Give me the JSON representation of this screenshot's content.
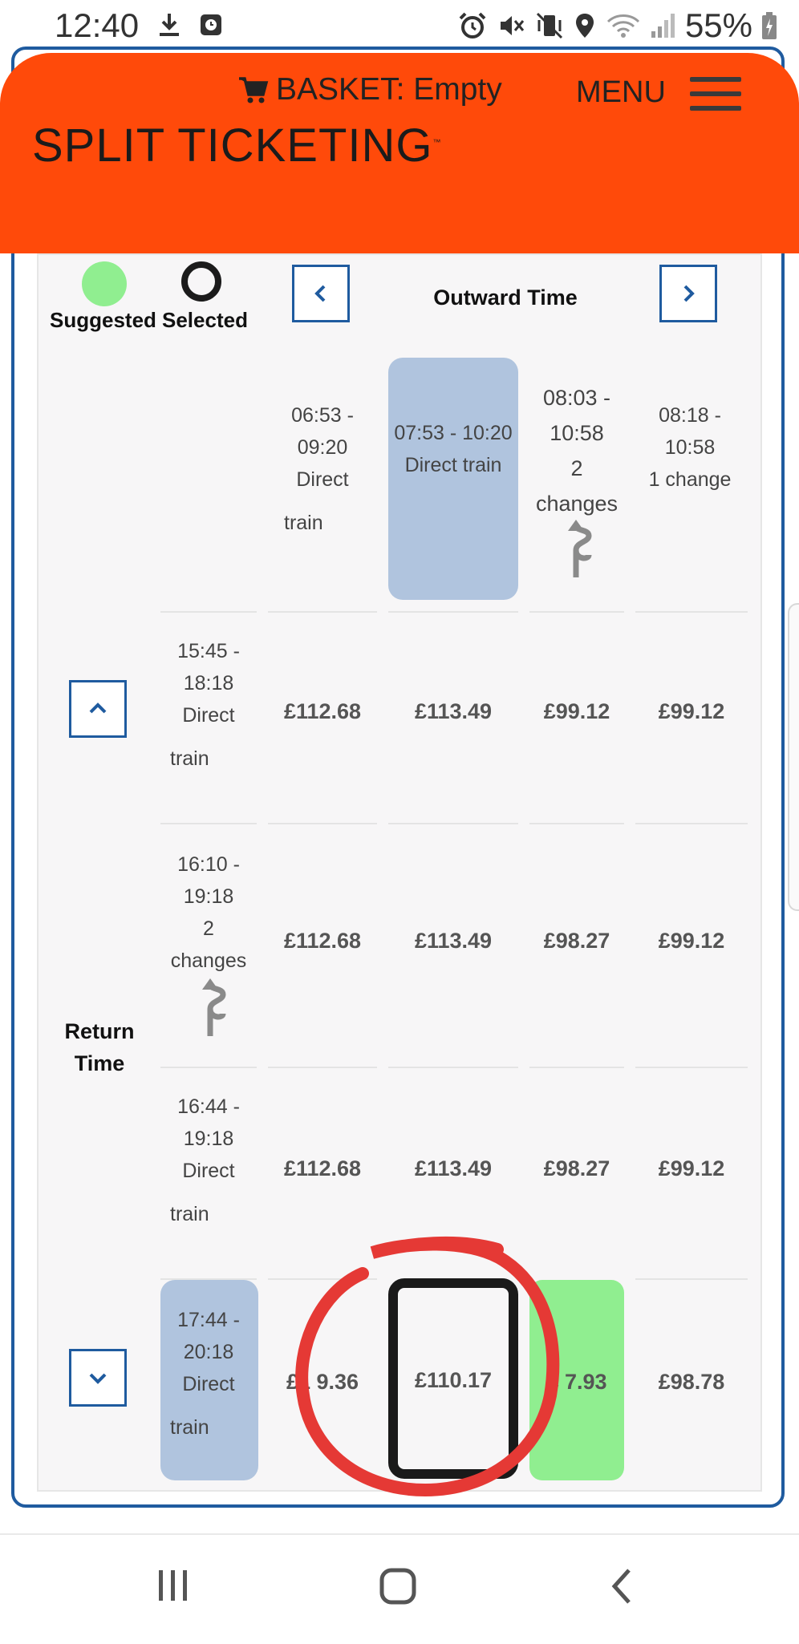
{
  "status_bar": {
    "time": "12:40",
    "battery": "55%",
    "left_icons": [
      "download-icon",
      "clock-app-icon"
    ],
    "right_icons": [
      "alarm-icon",
      "mute-icon",
      "vibrate-icon",
      "location-icon",
      "wifi-icon",
      "signal-icon",
      "battery-icon"
    ]
  },
  "header": {
    "basket_label": "BASKET: Empty",
    "menu_label": "MENU",
    "brand": "SPLIT TICKETING",
    "brand_tm": "™",
    "color": "#ff4a0a"
  },
  "legend": {
    "suggested": "Suggested",
    "selected": "Selected",
    "suggested_color": "#90ee90",
    "selected_color": "#1b1b1b"
  },
  "outward": {
    "title": "Outward Time",
    "columns": [
      {
        "lines": [
          "06:53 -",
          "09:20",
          "Direct",
          "train"
        ],
        "changes_icon": false
      },
      {
        "lines": [
          "07:53 - 10:20",
          "Direct train"
        ],
        "changes_icon": false,
        "highlight": "selected-outward"
      },
      {
        "lines": [
          "08:03 -",
          "10:58",
          "2",
          "changes"
        ],
        "changes_icon": true
      },
      {
        "lines": [
          "08:18 -",
          "10:58",
          "1 change"
        ],
        "changes_icon": false
      }
    ]
  },
  "return": {
    "title_line1": "Return",
    "title_line2": "Time",
    "rows": [
      {
        "lines": [
          "15:45 -",
          "18:18",
          "Direct",
          "train"
        ],
        "prices": [
          "£112.68",
          "£113.49",
          "£99.12",
          "£99.12"
        ]
      },
      {
        "lines": [
          "16:10 -",
          "19:18",
          "2",
          "changes"
        ],
        "prices": [
          "£112.68",
          "£113.49",
          "£98.27",
          "£99.12"
        ],
        "changes_icon": true
      },
      {
        "lines": [
          "16:44 -",
          "19:18",
          "Direct",
          "train"
        ],
        "prices": [
          "£112.68",
          "£113.49",
          "£98.27",
          "£99.12"
        ]
      },
      {
        "lines": [
          "17:44 -",
          "20:18",
          "Direct",
          "train"
        ],
        "prices": [
          "£1 9.36",
          "£110.17",
          "£ 7.93",
          "£98.78"
        ],
        "highlight": "selected-return"
      }
    ]
  },
  "colors": {
    "accent_blue": "#1f5b9f",
    "highlight_blue": "#b0c4de",
    "annotation_red": "#e53935"
  }
}
